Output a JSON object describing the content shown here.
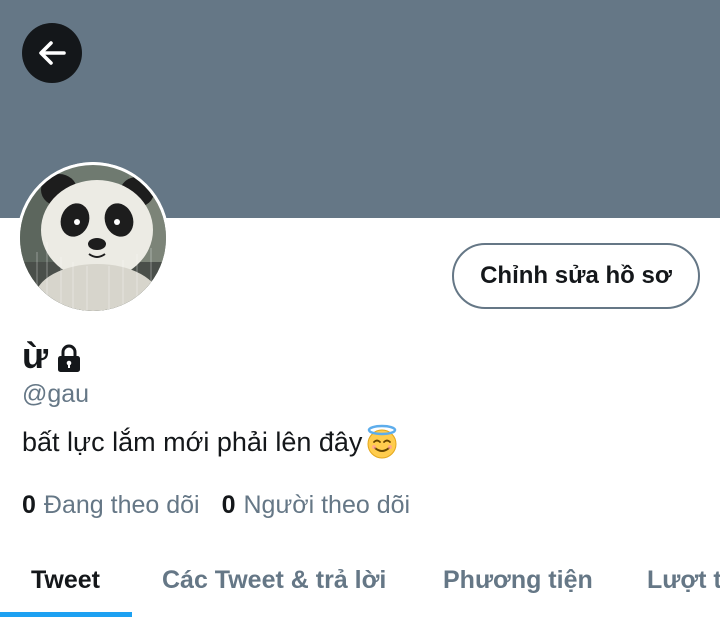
{
  "profile": {
    "display_name": "ừ",
    "handle": "@gau",
    "bio": "bất lực lắm mới phải lên đây",
    "edit_button_label": "Chỉnh sửa hồ sơ",
    "stats": {
      "following_count": "0",
      "following_label": "Đang theo dõi",
      "followers_count": "0",
      "followers_label": "Người theo dõi"
    }
  },
  "tabs": [
    {
      "label": "Tweet",
      "active": true
    },
    {
      "label": "Các Tweet & trả lời",
      "active": false
    },
    {
      "label": "Phương tiện",
      "active": false
    },
    {
      "label": "Lượt thích",
      "active": false
    }
  ],
  "icons": {
    "back": "arrow-left-icon",
    "lock": "lock-icon",
    "bio_emoji": "smiling-face-with-halo-emoji"
  },
  "colors": {
    "banner": "#657786",
    "accent": "#1da1f2",
    "text_primary": "#14171a",
    "text_secondary": "#657786"
  }
}
